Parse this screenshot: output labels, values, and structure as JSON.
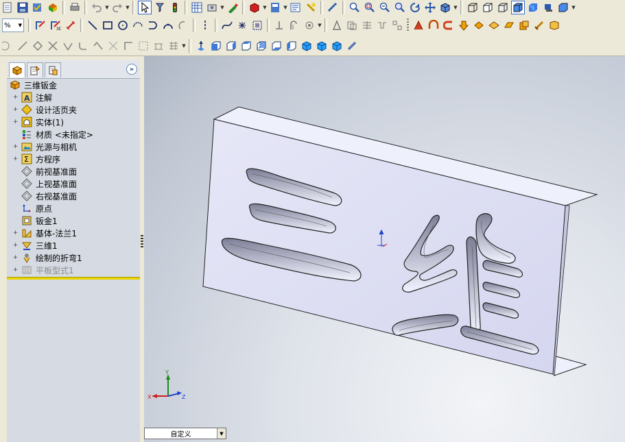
{
  "toolbars": {
    "row1": {
      "icons": [
        "new-doc-icon",
        "save-icon",
        "rebuild-icon",
        "print-icon",
        "undo-icon",
        "redo-icon",
        "select-icon",
        "select-filter-icon",
        "traffic-light-icon",
        "grid-icon",
        "options-icon",
        "sketch-icon",
        "materials-icon",
        "view-orient-icon",
        "file-props-icon",
        "help-icon",
        "measure-icon",
        "zoom-fit-icon",
        "zoom-area-icon",
        "zoom-in-out-icon",
        "zoom-selection-icon",
        "rotate-view-icon",
        "pan-icon",
        "view-orient-cube-icon",
        "display-wireframe-icon",
        "display-hidden-icon",
        "display-edges-icon",
        "display-shaded-edges-icon",
        "display-shaded-icon",
        "section-view-icon",
        "shadows-icon"
      ]
    },
    "row2": {
      "combo_label": "%",
      "icons": [
        "sketch-icon",
        "smart-dimension-icon",
        "line-icon",
        "rectangle-icon",
        "circle-icon",
        "centerpoint-arc-icon",
        "tangent-arc-icon",
        "three-point-arc-icon",
        "centerline-icon",
        "spline-icon",
        "point-icon",
        "convert-entities-icon",
        "trim-icon",
        "offset-icon",
        "mirror-icon",
        "linear-pattern-icon",
        "move-entities-icon",
        "base-flange-icon",
        "sketched-bend-icon",
        "edge-flange-icon",
        "hem-icon",
        "jog-icon",
        "fold-icon",
        "unfold-icon",
        "flatten-icon",
        "no-bends-icon",
        "insert-bends-icon",
        "closed-corner-icon"
      ]
    },
    "row3": {
      "icons": [
        "ellipse-icon",
        "polygon-icon",
        "construction-line-icon",
        "parabola-icon",
        "partial-ellipse-icon",
        "sketch-fillet-icon",
        "sketch-chamfer-icon",
        "grid-snap-icon",
        "table-icon",
        "move-icon",
        "view-front-icon",
        "view-back-icon",
        "view-left-icon",
        "view-right-icon",
        "view-top-icon",
        "view-bottom-icon",
        "view-isometric-icon",
        "view-trimetric-icon",
        "view-dimetric-icon",
        "normal-to-icon"
      ]
    }
  },
  "feature_manager": {
    "tabs": [
      "feature-manager-tab",
      "property-manager-tab",
      "configuration-manager-tab"
    ],
    "collapse_label": "»",
    "root": {
      "label": "三维钣金",
      "icon": "part-icon"
    },
    "items": [
      {
        "label": "注解",
        "icon": "annotations-icon",
        "expandable": true
      },
      {
        "label": "设计活页夹",
        "icon": "design-binder-icon",
        "expandable": true
      },
      {
        "label": "实体(1)",
        "icon": "solid-bodies-icon",
        "expandable": true
      },
      {
        "label": "材质 <未指定>",
        "icon": "material-icon",
        "expandable": false
      },
      {
        "label": "光源与相机",
        "icon": "lights-cameras-icon",
        "expandable": true
      },
      {
        "label": "方程序",
        "icon": "equations-icon",
        "expandable": true
      },
      {
        "label": "前视基准面",
        "icon": "plane-icon",
        "expandable": false
      },
      {
        "label": "上视基准面",
        "icon": "plane-icon",
        "expandable": false
      },
      {
        "label": "右视基准面",
        "icon": "plane-icon",
        "expandable": false
      },
      {
        "label": "原点",
        "icon": "origin-icon",
        "expandable": false
      },
      {
        "label": "钣金1",
        "icon": "sheet-metal-icon",
        "expandable": false
      },
      {
        "label": "基体-法兰1",
        "icon": "base-flange-feature-icon",
        "expandable": true
      },
      {
        "label": "三维1",
        "icon": "sketch-feature-icon",
        "expandable": true
      },
      {
        "label": "绘制的折弯1",
        "icon": "sketched-bend-feature-icon",
        "expandable": true
      },
      {
        "label": "平板型式1",
        "icon": "flat-pattern-icon",
        "expandable": true,
        "suppressed": true
      }
    ]
  },
  "viewport": {
    "view_combo": {
      "value": "自定义"
    },
    "model_text": [
      "三",
      "维"
    ],
    "triad_labels": {
      "x": "X",
      "y": "Y",
      "z": "Z"
    }
  }
}
